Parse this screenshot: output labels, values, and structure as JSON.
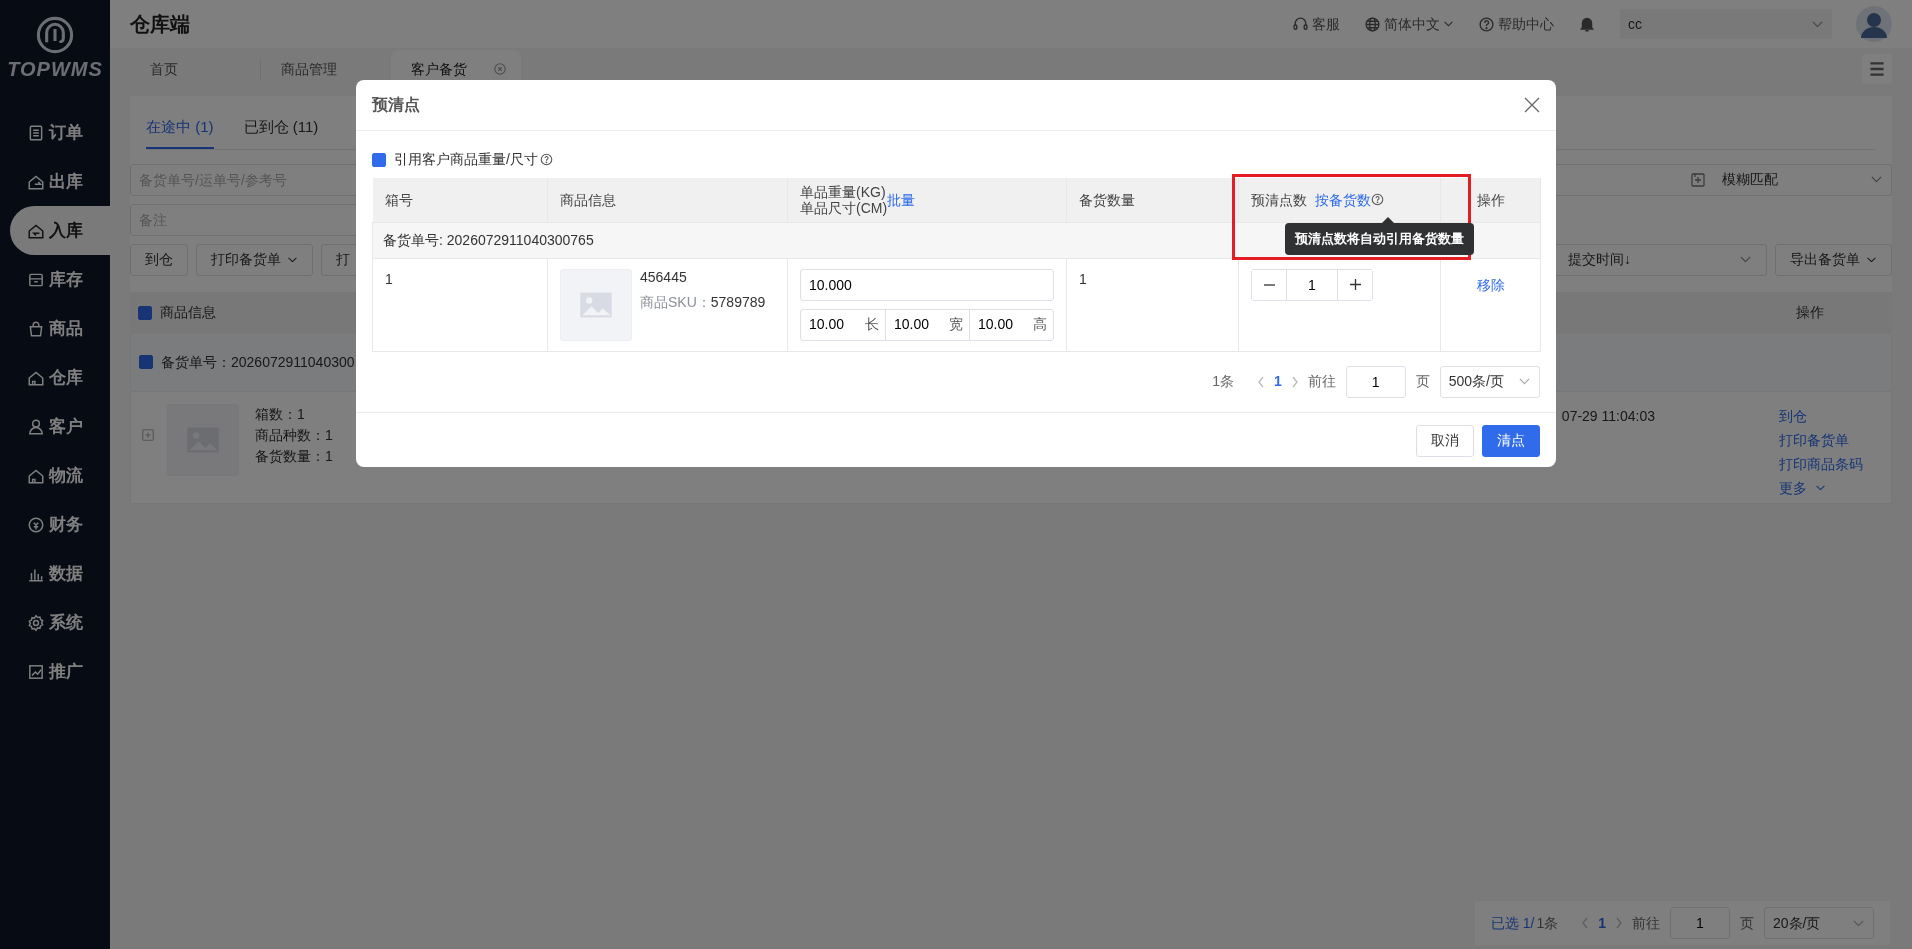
{
  "sidebar": {
    "logo": "TOPWMS",
    "items": [
      {
        "label": "订单",
        "kind": "list",
        "selected": false
      },
      {
        "label": "出库",
        "kind": "out",
        "selected": false
      },
      {
        "label": "入库",
        "kind": "in",
        "selected": true
      },
      {
        "label": "库存",
        "kind": "box",
        "selected": false
      },
      {
        "label": "商品",
        "kind": "bag",
        "selected": false
      },
      {
        "label": "仓库",
        "kind": "house",
        "selected": false
      },
      {
        "label": "客户",
        "kind": "person",
        "selected": false
      },
      {
        "label": "物流",
        "kind": "house",
        "selected": false
      },
      {
        "label": "财务",
        "kind": "coin",
        "selected": false
      },
      {
        "label": "数据",
        "kind": "bars",
        "selected": false
      },
      {
        "label": "系统",
        "kind": "gear",
        "selected": false
      },
      {
        "label": "推广",
        "kind": "chart",
        "selected": false
      }
    ]
  },
  "header": {
    "title": "仓库端",
    "links": [
      {
        "label": "客服",
        "kind": "headset",
        "dropdown": false
      },
      {
        "label": "简体中文",
        "kind": "globe",
        "dropdown": true
      },
      {
        "label": "帮助中心",
        "kind": "help",
        "dropdown": false
      }
    ],
    "account": "cc"
  },
  "page_tabs": [
    {
      "label": "首页",
      "selected": false,
      "closable": false
    },
    {
      "label": "商品管理",
      "selected": false,
      "closable": false
    },
    {
      "label": "客户备货",
      "selected": true,
      "closable": true
    }
  ],
  "status_tabs": [
    {
      "label": "在途中 (1)",
      "selected": true
    },
    {
      "label": "已到仓 (11)",
      "selected": false
    }
  ],
  "search": {
    "placeholder": "备货单号/运单号/参考号",
    "match_mode": "模糊匹配"
  },
  "note_field": {
    "placeholder": "备注"
  },
  "toolbar_buttons": [
    {
      "label": "到仓",
      "dropdown": false
    },
    {
      "label": "打印备货单",
      "dropdown": true
    },
    {
      "label": "打",
      "dropdown": false
    }
  ],
  "sort_select": "提交时间↓",
  "export_button": "导出备货单",
  "list_table": {
    "header_checked": true,
    "header_label": "商品信息",
    "action_header": "操作",
    "groups": [
      {
        "label": "备货单号：2026072911040300",
        "checked": true,
        "summary": [
          "箱数：1",
          "商品种数：1",
          "备货数量：1"
        ],
        "time": "07-29 11:04:03",
        "actions": [
          {
            "label": "到仓",
            "dropdown": false
          },
          {
            "label": "打印备货单",
            "dropdown": false
          },
          {
            "label": "打印商品条码",
            "dropdown": false
          },
          {
            "label": "更多",
            "dropdown": true
          }
        ]
      }
    ]
  },
  "list_pagination": {
    "selected_text": "已选 1/",
    "total": "1条",
    "current": "1",
    "goto_label": "前往",
    "goto_value": "1",
    "page_unit": "页",
    "page_size": "20条/页"
  },
  "modal": {
    "title": "预清点",
    "use_customer_dims": {
      "label": "引用客户商品重量/尺寸",
      "checked": true
    },
    "columns": [
      {
        "kind": "text",
        "label": "箱号"
      },
      {
        "kind": "text",
        "label": "商品信息"
      },
      {
        "kind": "batch",
        "lines": [
          "单品重量(KG)",
          "单品尺寸(CM)"
        ],
        "link": "批量"
      },
      {
        "kind": "text",
        "label": "备货数量"
      },
      {
        "kind": "fill",
        "label": "预清点数",
        "link": "按备货数",
        "highlighted": true,
        "tooltip": "预清点数将自动引用备货数量"
      },
      {
        "kind": "center",
        "label": "操作"
      }
    ],
    "groups": [
      {
        "label": "备货单号: 2026072911040300765",
        "rows": [
          {
            "box_no": "1",
            "product": {
              "name": "456445",
              "sku_label": "商品SKU：",
              "sku": "5789789"
            },
            "weight": "10.000",
            "dims": [
              {
                "value": "10.00",
                "unit": "长"
              },
              {
                "value": "10.00",
                "unit": "宽"
              },
              {
                "value": "10.00",
                "unit": "高"
              }
            ],
            "stock_qty": "1",
            "count": "1",
            "action": "移除"
          }
        ]
      }
    ],
    "pagination": {
      "total": "1条",
      "current": "1",
      "goto_label": "前往",
      "goto_value": "1",
      "page_unit": "页",
      "page_size": "500条/页"
    },
    "buttons": [
      {
        "label": "取消",
        "kind": "secondary"
      },
      {
        "label": "清点",
        "kind": "primary"
      }
    ]
  }
}
